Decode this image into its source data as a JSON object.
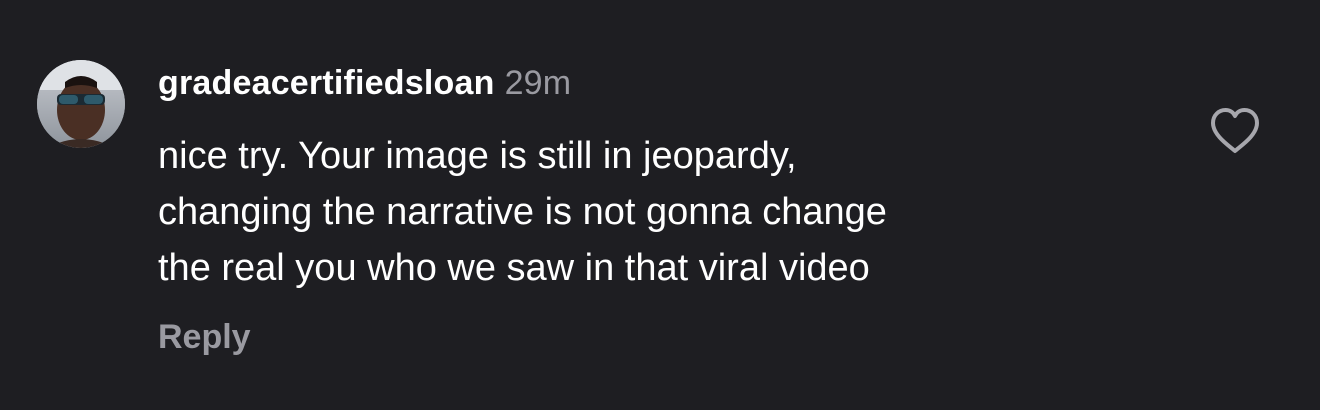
{
  "comment": {
    "username": "gradeacertifiedsloan",
    "timestamp": "29m",
    "text_lines": [
      "nice try. Your image is still in jeopardy,",
      "changing the narrative is not gonna change",
      "the real you who we saw in that viral video"
    ],
    "reply_label": "Reply",
    "like_icon": "heart-outline-icon",
    "avatar_icon": "user-avatar-photo"
  },
  "colors": {
    "background": "#1e1e22",
    "primary_text": "#ffffff",
    "secondary_text": "#9a9aa1"
  }
}
